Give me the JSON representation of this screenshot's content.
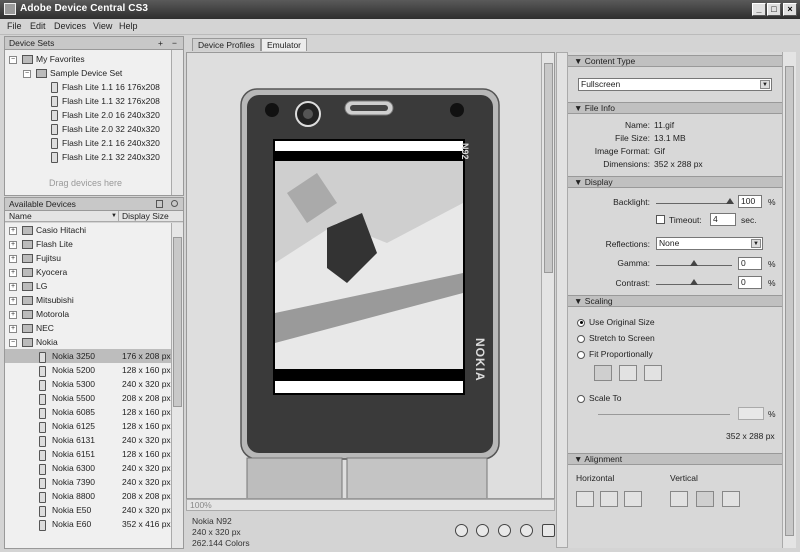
{
  "window": {
    "title": "Adobe Device Central CS3",
    "min": "_",
    "max": "□",
    "close": "×"
  },
  "menu": [
    "File",
    "Edit",
    "Devices",
    "View",
    "Help"
  ],
  "device_sets": {
    "header": "Device Sets",
    "add": "+",
    "remove": "−",
    "favorites": "My Favorites",
    "sample": "Sample Device Set",
    "items": [
      "Flash Lite 1.1 16 176x208",
      "Flash Lite 1.1 32 176x208",
      "Flash Lite 2.0 16 240x320",
      "Flash Lite 2.0 32 240x320",
      "Flash Lite 2.1 16 240x320",
      "Flash Lite 2.1 32 240x320"
    ],
    "drag_hint": "Drag devices here"
  },
  "available": {
    "header": "Available Devices",
    "col_name": "Name",
    "col_size": "Display Size",
    "groups": [
      "Casio Hitachi",
      "Flash Lite",
      "Fujitsu",
      "Kyocera",
      "LG",
      "Mitsubishi",
      "Motorola",
      "NEC",
      "Nokia"
    ],
    "devices": [
      {
        "name": "Nokia 3250",
        "size": "176 x 208 px"
      },
      {
        "name": "Nokia 5200",
        "size": "128 x 160 px"
      },
      {
        "name": "Nokia 5300",
        "size": "240 x 320 px"
      },
      {
        "name": "Nokia 5500",
        "size": "208 x 208 px"
      },
      {
        "name": "Nokia 6085",
        "size": "128 x 160 px"
      },
      {
        "name": "Nokia 6125",
        "size": "128 x 160 px"
      },
      {
        "name": "Nokia 6131",
        "size": "240 x 320 px"
      },
      {
        "name": "Nokia 6151",
        "size": "128 x 160 px"
      },
      {
        "name": "Nokia 6300",
        "size": "240 x 320 px"
      },
      {
        "name": "Nokia 7390",
        "size": "240 x 320 px"
      },
      {
        "name": "Nokia 8800",
        "size": "208 x 208 px"
      },
      {
        "name": "Nokia E50",
        "size": "240 x 320 px"
      },
      {
        "name": "Nokia E60",
        "size": "352 x 416 px"
      }
    ]
  },
  "tabs": {
    "profiles": "Device Profiles",
    "emulator": "Emulator"
  },
  "phone": {
    "model": "N92",
    "brand": "NOKIA"
  },
  "status": {
    "zoom": "100%",
    "device": "Nokia N92",
    "resolution": "240 x 320 px",
    "colors": "262.144 Colors"
  },
  "content_type": {
    "header": "Content Type",
    "value": "Fullscreen"
  },
  "file_info": {
    "header": "File Info",
    "name_label": "Name:",
    "name": "11.gif",
    "size_label": "File Size:",
    "size": "13.1 MB",
    "format_label": "Image Format:",
    "format": "Gif",
    "dim_label": "Dimensions:",
    "dim": "352 x 288 px"
  },
  "display": {
    "header": "Display",
    "backlight_label": "Backlight:",
    "backlight": "100",
    "pct": "%",
    "timeout_label": "Timeout:",
    "timeout": "4",
    "sec": "sec.",
    "reflections_label": "Reflections:",
    "reflections": "None",
    "gamma_label": "Gamma:",
    "gamma": "0",
    "contrast_label": "Contrast:",
    "contrast": "0"
  },
  "scaling": {
    "header": "Scaling",
    "original": "Use Original Size",
    "stretch": "Stretch to Screen",
    "fit": "Fit Proportionally",
    "scale_to": "Scale To",
    "pct": "%",
    "result": "352 x 288 px"
  },
  "alignment": {
    "header": "Alignment",
    "horizontal": "Horizontal",
    "vertical": "Vertical"
  }
}
